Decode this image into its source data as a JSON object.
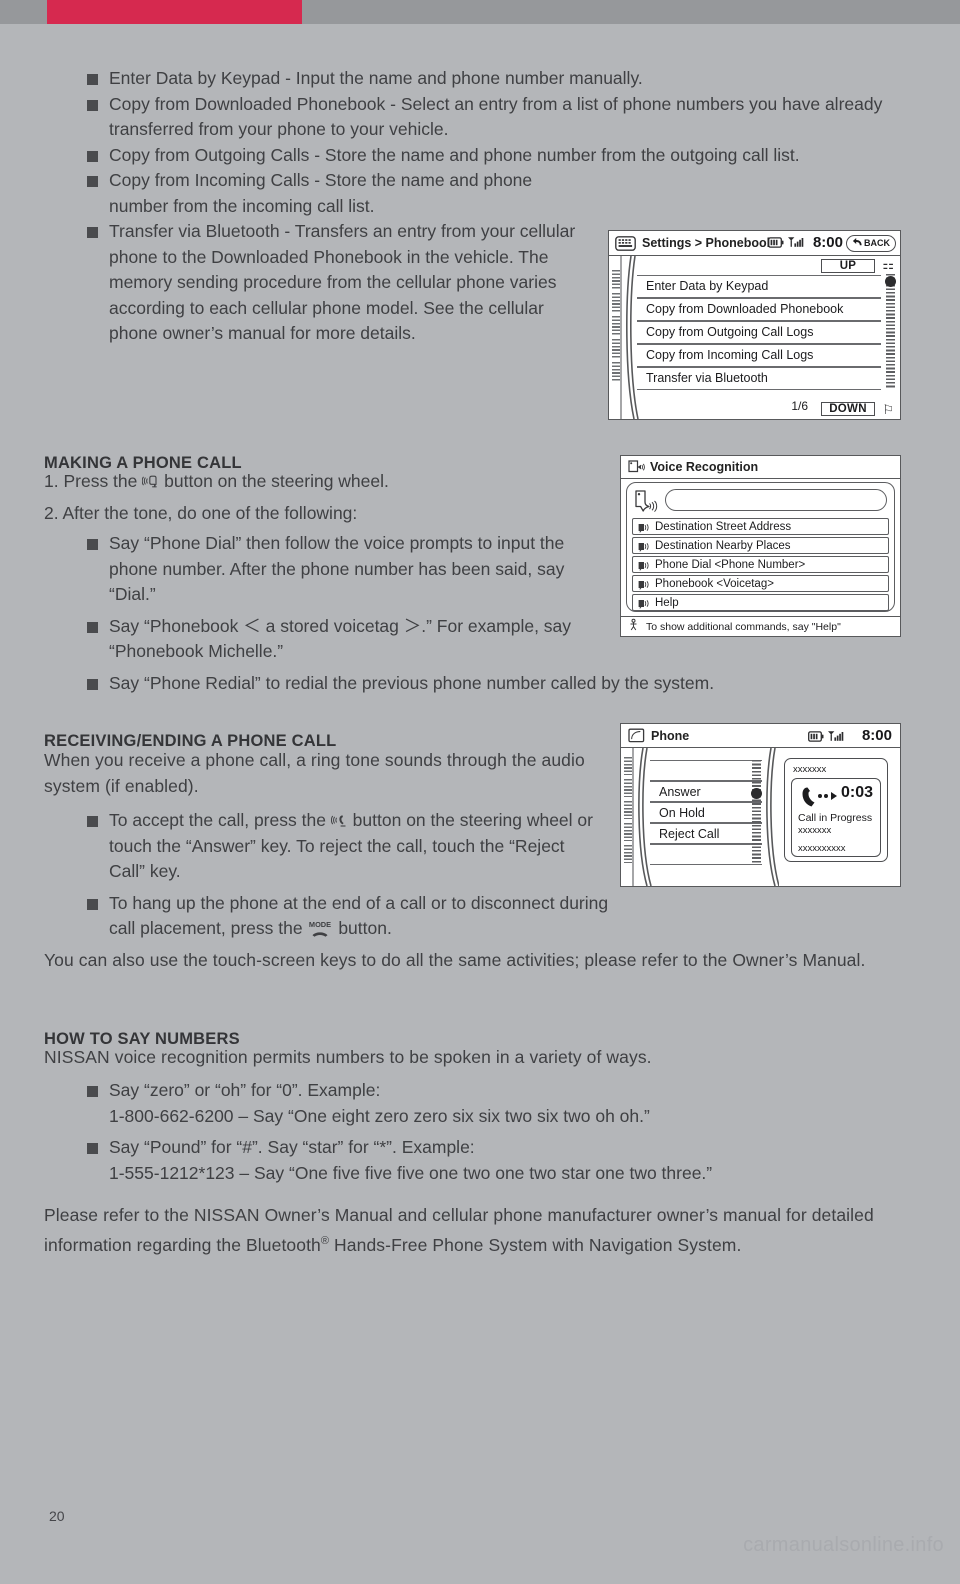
{
  "page": {
    "number": "20",
    "watermark": "carmanualsonline.info",
    "accent_color": "#d6294f",
    "bar_color": "#96989b",
    "background_color": "#b4b6b9"
  },
  "intro_bullets": [
    "Enter Data by Keypad - Input the name and phone number manually.",
    "Copy from Downloaded Phonebook - Select an entry from a list of phone numbers you have already transferred from your phone to your vehicle.",
    "Copy from Outgoing Calls - Store the name and phone number from the outgoing call list.",
    "Copy from Incoming Calls - Store the name and phone number from the incoming call list.",
    "Transfer via Bluetooth - Transfers an entry from your cellular phone to the Downloaded Phonebook in the vehicle. The memory sending procedure from the cellular phone varies according to each cellular phone model. See the cellular phone owner’s manual for more details."
  ],
  "making_call": {
    "heading": "MAKING A PHONE CALL",
    "step1_pre": "1. Press the",
    "step1_post": "button on the steering wheel.",
    "step1_icon": "steering-wheel-phone-talk-icon",
    "step2": "2. After the tone, do one of the following:",
    "bullets": [
      "Say “Phone Dial” then follow the voice prompts to input the phone number. After the phone number has been said, say “Dial.”",
      "Say “Phonebook ＜ a stored voicetag ＞.” For example, say “Phonebook Michelle.”",
      "Say “Phone Redial” to redial the previous phone number called by the system."
    ]
  },
  "receiving": {
    "heading": "RECEIVING/ENDING A PHONE CALL",
    "intro": "When you receive a phone call, a ring tone sounds through the audio system (if enabled).",
    "bullet1_pre": "To accept the call, press the",
    "bullet1_post": "button on the steering wheel or touch the “Answer” key. To reject the call, touch the “Reject Call” key.",
    "bullet1_icon": "steering-wheel-phone-talk-icon",
    "bullet2_pre": "To hang up the phone at the end of a call or to disconnect during call placement, press the",
    "bullet2_post": "button.",
    "bullet2_icon": "mode-hangup-icon",
    "closing": "You can also use the touch-screen keys to do all the same activities; please refer to the Owner’s Manual."
  },
  "numbers": {
    "heading": "HOW TO SAY NUMBERS",
    "intro": "NISSAN voice recognition permits numbers to be spoken in a variety of ways.",
    "bullets": [
      {
        "line1": "Say “zero” or “oh” for “0”. Example:",
        "line2": "1-800-662-6200 – Say “One eight zero zero six six two six two oh oh.”"
      },
      {
        "line1": "Say “Pound” for “#”. Say “star” for “*”. Example:",
        "line2": "1-555-1212*123 – Say “One five five five one two one two star one two three.”"
      }
    ]
  },
  "closing_note": {
    "part1": "Please refer to the NISSAN Owner’s Manual and cellular phone manufacturer owner’s manual for detailed information regarding the Bluetooth",
    "sup": "®",
    "part2": " Hands-Free Phone System with Navigation System."
  },
  "screen_phonebook": {
    "title": "Settings > Phonebook",
    "title_icon": "keypad-icon",
    "clock": "8:00",
    "battery_icon": "battery-icon",
    "signal_icon": "signal-bars-icon",
    "back_label": "BACK",
    "back_icon": "back-arrow-icon",
    "up_label": "UP",
    "down_label": "DOWN",
    "page_indicator": "1/6",
    "items": [
      "Enter Data by Keypad",
      "Copy from Downloaded Phonebook",
      "Copy from Outgoing Call Logs",
      "Copy from Incoming Call Logs",
      "Transfer via Bluetooth"
    ]
  },
  "screen_voice": {
    "title": "Voice Recognition",
    "title_icon": "voice-recognition-icon",
    "prompt_icon": "speech-bubble-icon",
    "input_value": "",
    "commands": [
      "Destination Street Address",
      "Destination Nearby Places",
      "Phone Dial <Phone Number>",
      "Phonebook <Voicetag>",
      "Help"
    ],
    "footer": "To show additional commands, say \"Help\"",
    "footer_icon": "hint-icon"
  },
  "screen_phone": {
    "title": "Phone",
    "title_icon": "phone-handset-icon",
    "clock": "8:00",
    "battery_icon": "battery-icon",
    "signal_icon": "signal-bars-icon",
    "menu": [
      "",
      "Answer",
      "On Hold",
      "Reject Call",
      ""
    ],
    "caller_top": "xxxxxxx",
    "call_timer": "0:03",
    "call_icon": "call-active-icon",
    "call_status": "Call in Progress",
    "call_name": "xxxxxxx",
    "call_number": "xxxxxxxxxx"
  }
}
